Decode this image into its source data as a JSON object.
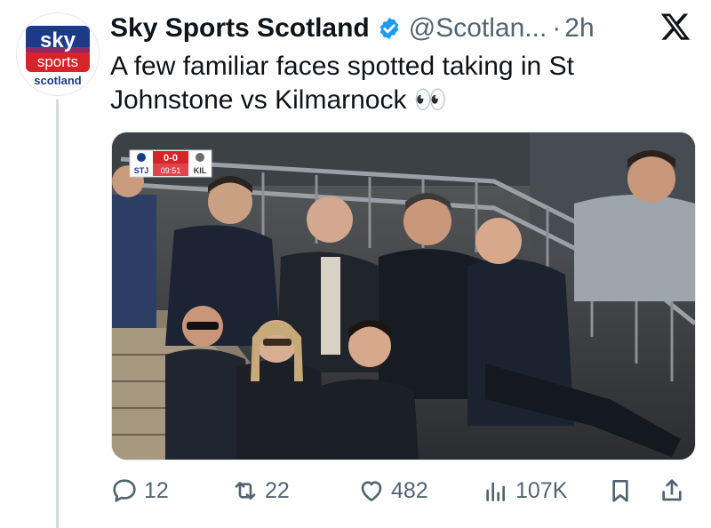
{
  "account": {
    "display_name": "Sky Sports Scotland",
    "handle": "@Scotlan...",
    "separator": "·",
    "time": "2h",
    "verified_color": "#1d9bf0",
    "logo_text": {
      "top": "sky",
      "middle": "sports",
      "bottom": "scotland"
    }
  },
  "tweet": {
    "text": "A few familiar faces spotted taking in St Johnstone vs Kilmarnock 👀"
  },
  "scorebug": {
    "home": "STJ",
    "away": "KIL",
    "score": "0-0",
    "clock": "09:51"
  },
  "actions": {
    "replies": "12",
    "reposts": "22",
    "likes": "482",
    "views": "107K"
  },
  "colors": {
    "text": "#0f1419",
    "muted": "#536471",
    "brand_red": "#d8232a",
    "brand_blue": "#1c3a8a"
  }
}
